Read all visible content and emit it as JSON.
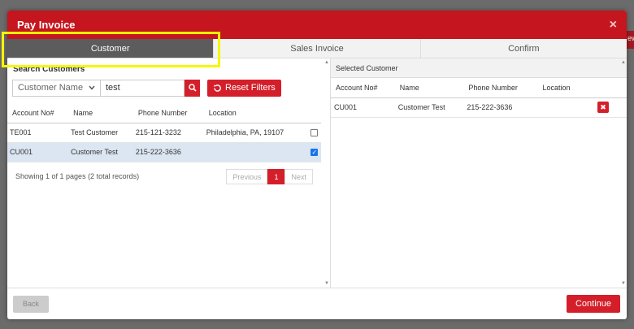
{
  "modal": {
    "title": "Pay Invoice",
    "close_glyph": "×"
  },
  "tabs": [
    {
      "label": "Customer",
      "active": true
    },
    {
      "label": "Sales Invoice",
      "active": false
    },
    {
      "label": "Confirm",
      "active": false
    }
  ],
  "search": {
    "label": "Search Customers",
    "field_select": "Customer Name",
    "query": "test",
    "reset_label": "Reset Filters"
  },
  "results": {
    "columns": [
      "Account No#",
      "Name",
      "Phone Number",
      "Location"
    ],
    "rows": [
      {
        "account": "TE001",
        "name": "Test Customer",
        "phone": "215-121-3232",
        "location": "Philadelphia, PA, 19107",
        "checked": false
      },
      {
        "account": "CU001",
        "name": "Customer Test",
        "phone": "215-222-3636",
        "location": "",
        "checked": true
      }
    ],
    "pager_info": "Showing 1 of 1 pages (2 total records)",
    "prev_label": "Previous",
    "page": "1",
    "next_label": "Next"
  },
  "selected": {
    "title": "Selected Customer",
    "columns": [
      "Account No#",
      "Name",
      "Phone Number",
      "Location"
    ],
    "rows": [
      {
        "account": "CU001",
        "name": "Customer Test",
        "phone": "215-222-3636",
        "location": ""
      }
    ]
  },
  "footer": {
    "back_label": "Back",
    "continue_label": "Continue"
  },
  "colors": {
    "brand_red": "#d41f2a",
    "header_red": "#c5161f",
    "active_tab": "#5c5c5c",
    "highlight": "#f6f600"
  }
}
